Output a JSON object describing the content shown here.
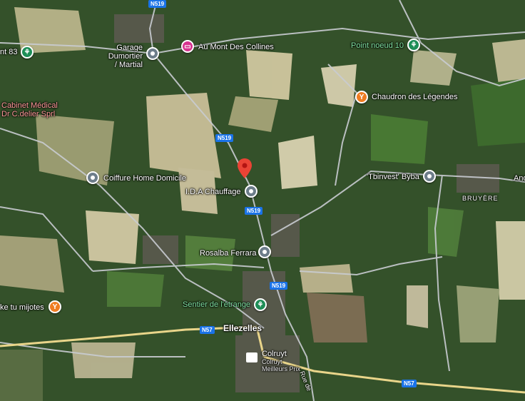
{
  "map": {
    "roads": {
      "n519": "N519",
      "n57": "N57",
      "rue": "Rue de"
    },
    "places": [
      {
        "id": "garage",
        "name": "Garage Dumortier\n/ Martial",
        "type": "grey"
      },
      {
        "id": "mont",
        "name": "Au Mont Des Collines",
        "type": "pink"
      },
      {
        "id": "point",
        "name": "Point noeud 10",
        "type": "green"
      },
      {
        "id": "chaudron",
        "name": "Chaudron des Légendes",
        "type": "orange"
      },
      {
        "id": "cabinet",
        "name": "Cabinet Médical\nDr C.delier Sprl",
        "type": "red"
      },
      {
        "id": "coiffure",
        "name": "Coiffure Home Domicile",
        "type": "grey"
      },
      {
        "id": "ida",
        "name": "I.D.A Chauffage",
        "type": "grey"
      },
      {
        "id": "tbinvest",
        "name": "'Tbinvest' Byba",
        "type": "grey"
      },
      {
        "id": "rosalba",
        "name": "Rosalba Ferrara",
        "type": "grey"
      },
      {
        "id": "sentier",
        "name": "Sentier de l'étrange",
        "type": "green"
      },
      {
        "id": "mijotes",
        "name": "ke tu mijotes",
        "type": "orange"
      },
      {
        "id": "colruyt",
        "name": "Colruyt",
        "sub": "Colruyt\nMeilleurs Prix",
        "type": "shop"
      },
      {
        "id": "pt83",
        "name": "nt 83",
        "type": "green"
      },
      {
        "id": "and",
        "name": "And",
        "type": "text"
      }
    ],
    "towns": {
      "ellezelles": "Ellezelles",
      "bruyere": "BRUYÈRE"
    }
  }
}
